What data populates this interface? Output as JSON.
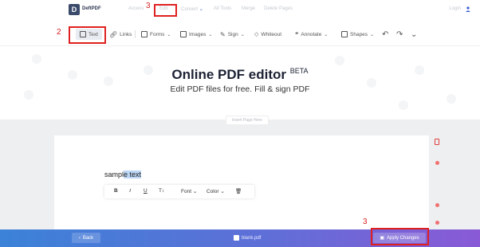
{
  "nav": {
    "logo_letter": "D",
    "logo_text": "DeftPDF",
    "items": [
      "Access",
      "Edit",
      "Convert",
      "All Tools",
      "Merge",
      "Delete Pages"
    ],
    "login": "Login"
  },
  "annotations": {
    "n1": "3",
    "n2": "2",
    "n3": "3"
  },
  "toolbar": {
    "text": "Text",
    "links": "Links",
    "forms": "Forms",
    "images": "Images",
    "sign": "Sign",
    "whiteout": "Whiteout",
    "annotate": "Annotate",
    "shapes": "Shapes"
  },
  "hero": {
    "title": "Online PDF editor",
    "beta": "BETA",
    "subtitle": "Edit PDF files for free. Fill & sign PDF"
  },
  "new_page": "Insert Page Here",
  "document": {
    "sample_plain": "sampl",
    "sample_highlight": "e text",
    "format": {
      "bold": "B",
      "italic": "I",
      "underline": "U",
      "size": "T↕",
      "font": "Font",
      "color": "Color"
    }
  },
  "bottom": {
    "back": "Back",
    "filename": "blank.pdf",
    "apply": "Apply Changes"
  },
  "colors": {
    "annotation": "#e02020",
    "gradient_start": "#3b82d8",
    "gradient_end": "#8a5ad6"
  }
}
